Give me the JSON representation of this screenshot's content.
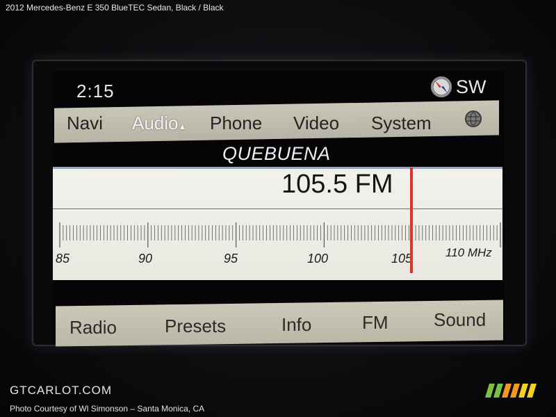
{
  "caption": "2012 Mercedes-Benz E 350 BlueTEC Sedan,  Black / Black",
  "clock": "2:15",
  "compass_direction": "SW",
  "menu": {
    "items": [
      "Navi",
      "Audio",
      "Phone",
      "Video",
      "System"
    ],
    "active": "Audio",
    "globe_icon": "globe-icon"
  },
  "station_name": "QUEBUENA",
  "frequency": "105.5 FM",
  "tuner_scale": {
    "labels": [
      "85",
      "90",
      "95",
      "100",
      "105",
      "110 MHz"
    ],
    "current": 105.5
  },
  "bottom_menu": [
    "Radio",
    "Presets",
    "Info",
    "FM",
    "Sound"
  ],
  "watermark": "GTCARLOT.COM",
  "credit": "Photo Courtesy of Wl Simonson – Santa Monica, CA",
  "colors": {
    "needle": "#e0312b",
    "menubar": "#c6c3b3"
  }
}
